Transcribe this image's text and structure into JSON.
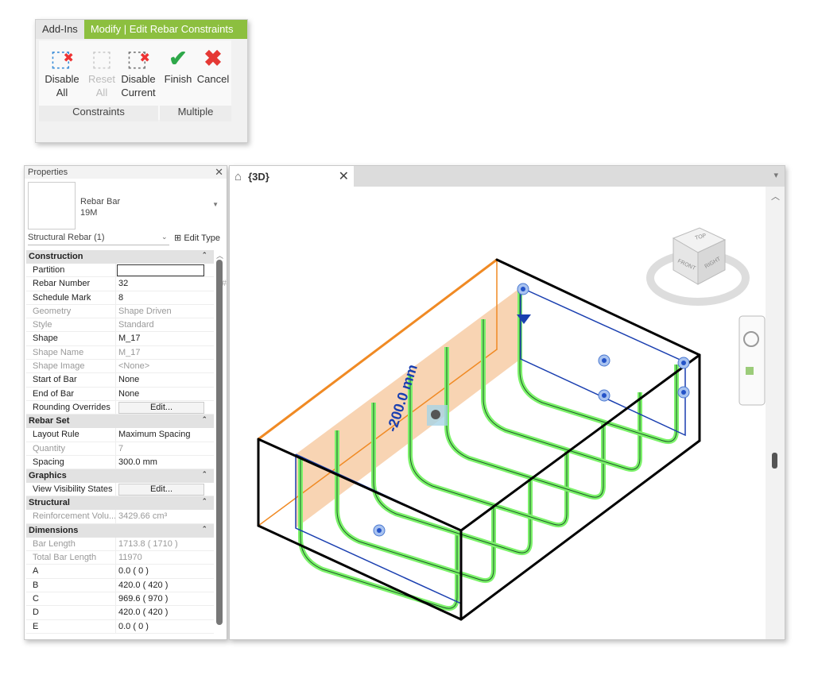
{
  "ribbon": {
    "tabs": [
      "Add-Ins",
      "Modify | Edit Rebar Constraints"
    ],
    "buttons": [
      {
        "l1": "Disable",
        "l2": "All",
        "icon": "disable-all-icon"
      },
      {
        "l1": "Reset",
        "l2": "All",
        "icon": "reset-all-icon"
      },
      {
        "l1": "Disable",
        "l2": "Current",
        "icon": "disable-current-icon"
      },
      {
        "l1": "Finish",
        "l2": "",
        "icon": "check-icon"
      },
      {
        "l1": "Cancel",
        "l2": "",
        "icon": "cross-icon"
      }
    ],
    "groups": [
      "Constraints",
      "Multiple"
    ]
  },
  "properties": {
    "title": "Properties",
    "type_line1": "Rebar Bar",
    "type_line2": "19M",
    "selector": "Structural Rebar (1)",
    "edit_type": "Edit Type",
    "sections": [
      {
        "name": "Construction",
        "rows": [
          [
            "Partition",
            ""
          ],
          [
            "Rebar Number",
            "32"
          ],
          [
            "Schedule Mark",
            "8"
          ],
          [
            "Geometry",
            "Shape Driven"
          ],
          [
            "Style",
            "Standard"
          ],
          [
            "Shape",
            "M_17"
          ],
          [
            "Shape Name",
            "M_17"
          ],
          [
            "Shape Image",
            "<None>"
          ],
          [
            "Start of Bar",
            "None"
          ],
          [
            "End of Bar",
            "None"
          ],
          [
            "Rounding Overrides",
            "Edit..."
          ]
        ]
      },
      {
        "name": "Rebar Set",
        "rows": [
          [
            "Layout Rule",
            "Maximum Spacing"
          ],
          [
            "Quantity",
            "7"
          ],
          [
            "Spacing",
            "300.0 mm"
          ]
        ]
      },
      {
        "name": "Graphics",
        "rows": [
          [
            "View Visibility States",
            "Edit..."
          ]
        ]
      },
      {
        "name": "Structural",
        "rows": [
          [
            "Reinforcement Volu...",
            "3429.66 cm³"
          ]
        ]
      },
      {
        "name": "Dimensions",
        "rows": [
          [
            "Bar Length",
            "1713.8 ( 1710 )"
          ],
          [
            "Total Bar Length",
            "11970"
          ],
          [
            "A",
            "0.0 ( 0 )"
          ],
          [
            "B",
            "420.0 ( 420 )"
          ],
          [
            "C",
            "969.6 ( 970 )"
          ],
          [
            "D",
            "420.0 ( 420 )"
          ],
          [
            "E",
            "0.0 ( 0 )"
          ]
        ]
      }
    ],
    "readonly": [
      "Geometry",
      "Style",
      "Shape Name",
      "Shape Image",
      "Quantity",
      "Reinforcement Volu...",
      "Bar Length",
      "Total Bar Length"
    ]
  },
  "view": {
    "tab": "{3D}",
    "dimension": "-200.0 mm",
    "viewcube": {
      "top": "TOP",
      "front": "FRONT",
      "right": "RIGHT"
    },
    "rebar_count": 7,
    "colors": {
      "rebar": "#7cf26a",
      "outline": "#1a3fb0",
      "orange": "#f08a24",
      "plane": "#f6c9a0"
    }
  }
}
